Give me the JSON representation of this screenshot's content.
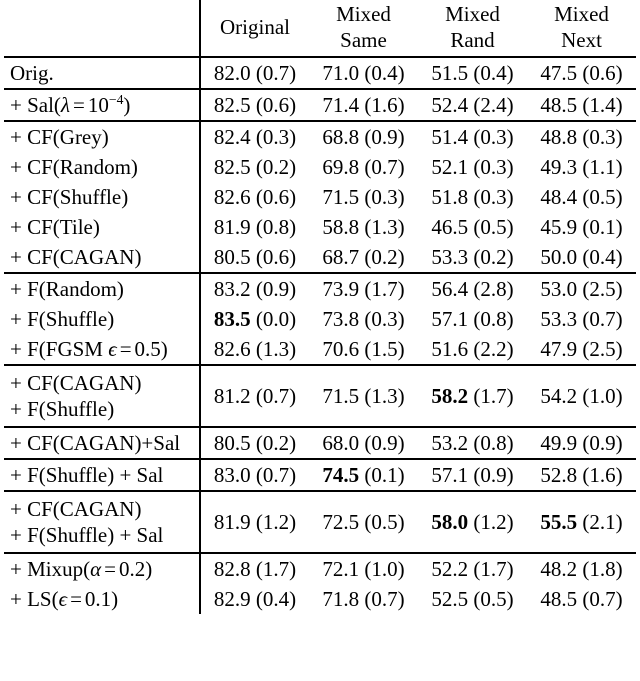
{
  "table": {
    "columns": [
      {
        "id": "label",
        "header_line1": "",
        "header_line2": ""
      },
      {
        "id": "original",
        "header_line1": "Original",
        "header_line2": ""
      },
      {
        "id": "mixed_same",
        "header_line1": "Mixed",
        "header_line2": "Same"
      },
      {
        "id": "mixed_rand",
        "header_line1": "Mixed",
        "header_line2": "Rand"
      },
      {
        "id": "mixed_next",
        "header_line1": "Mixed",
        "header_line2": "Next"
      }
    ],
    "groups": [
      {
        "rows": [
          {
            "label_line1": "Orig.",
            "label_line2": "",
            "cells": [
              {
                "mean": "82.0",
                "sd": "(0.7)",
                "bold": false
              },
              {
                "mean": "71.0",
                "sd": "(0.4)",
                "bold": false
              },
              {
                "mean": "51.5",
                "sd": "(0.4)",
                "bold": false
              },
              {
                "mean": "47.5",
                "sd": "(0.6)",
                "bold": false
              }
            ]
          }
        ]
      },
      {
        "rows": [
          {
            "label_line1": "+ Sal(λ = 10⁻⁴)",
            "label_math": true,
            "label_parts": {
              "prefix": "+ Sal(",
              "symbol": "λ",
              "relation": "=",
              "base": "10",
              "exponent": "−4",
              "suffix": ")"
            },
            "label_line2": "",
            "cells": [
              {
                "mean": "82.5",
                "sd": "(0.6)",
                "bold": false
              },
              {
                "mean": "71.4",
                "sd": "(1.6)",
                "bold": false
              },
              {
                "mean": "52.4",
                "sd": "(2.4)",
                "bold": false
              },
              {
                "mean": "48.5",
                "sd": "(1.4)",
                "bold": false
              }
            ]
          }
        ]
      },
      {
        "rows": [
          {
            "label_line1": "+ CF(Grey)",
            "label_line2": "",
            "cells": [
              {
                "mean": "82.4",
                "sd": "(0.3)",
                "bold": false
              },
              {
                "mean": "68.8",
                "sd": "(0.9)",
                "bold": false
              },
              {
                "mean": "51.4",
                "sd": "(0.3)",
                "bold": false
              },
              {
                "mean": "48.8",
                "sd": "(0.3)",
                "bold": false
              }
            ]
          },
          {
            "label_line1": "+ CF(Random)",
            "label_line2": "",
            "cells": [
              {
                "mean": "82.5",
                "sd": "(0.2)",
                "bold": false
              },
              {
                "mean": "69.8",
                "sd": "(0.7)",
                "bold": false
              },
              {
                "mean": "52.1",
                "sd": "(0.3)",
                "bold": false
              },
              {
                "mean": "49.3",
                "sd": "(1.1)",
                "bold": false
              }
            ]
          },
          {
            "label_line1": "+ CF(Shuffle)",
            "label_line2": "",
            "cells": [
              {
                "mean": "82.6",
                "sd": "(0.6)",
                "bold": false
              },
              {
                "mean": "71.5",
                "sd": "(0.3)",
                "bold": false
              },
              {
                "mean": "51.8",
                "sd": "(0.3)",
                "bold": false
              },
              {
                "mean": "48.4",
                "sd": "(0.5)",
                "bold": false
              }
            ]
          },
          {
            "label_line1": "+ CF(Tile)",
            "label_line2": "",
            "cells": [
              {
                "mean": "81.9",
                "sd": "(0.8)",
                "bold": false
              },
              {
                "mean": "58.8",
                "sd": "(1.3)",
                "bold": false
              },
              {
                "mean": "46.5",
                "sd": "(0.5)",
                "bold": false
              },
              {
                "mean": "45.9",
                "sd": "(0.1)",
                "bold": false
              }
            ]
          },
          {
            "label_line1": "+ CF(CAGAN)",
            "label_line2": "",
            "cells": [
              {
                "mean": "80.5",
                "sd": "(0.6)",
                "bold": false
              },
              {
                "mean": "68.7",
                "sd": "(0.2)",
                "bold": false
              },
              {
                "mean": "53.3",
                "sd": "(0.2)",
                "bold": false
              },
              {
                "mean": "50.0",
                "sd": "(0.4)",
                "bold": false
              }
            ]
          }
        ]
      },
      {
        "rows": [
          {
            "label_line1": "+ F(Random)",
            "label_line2": "",
            "cells": [
              {
                "mean": "83.2",
                "sd": "(0.9)",
                "bold": false
              },
              {
                "mean": "73.9",
                "sd": "(1.7)",
                "bold": false
              },
              {
                "mean": "56.4",
                "sd": "(2.8)",
                "bold": false
              },
              {
                "mean": "53.0",
                "sd": "(2.5)",
                "bold": false
              }
            ]
          },
          {
            "label_line1": "+ F(Shuffle)",
            "label_line2": "",
            "cells": [
              {
                "mean": "83.5",
                "sd": "(0.0)",
                "bold": true
              },
              {
                "mean": "73.8",
                "sd": "(0.3)",
                "bold": false
              },
              {
                "mean": "57.1",
                "sd": "(0.8)",
                "bold": false
              },
              {
                "mean": "53.3",
                "sd": "(0.7)",
                "bold": false
              }
            ]
          },
          {
            "label_line1": "+ F(FGSM ϵ = 0.5)",
            "label_math": true,
            "label_parts": {
              "prefix": "+ F(FGSM ",
              "symbol": "ϵ",
              "relation": "=",
              "base": "0.5",
              "exponent": "",
              "suffix": ")"
            },
            "label_line2": "",
            "cells": [
              {
                "mean": "82.6",
                "sd": "(1.3)",
                "bold": false
              },
              {
                "mean": "70.6",
                "sd": "(1.5)",
                "bold": false
              },
              {
                "mean": "51.6",
                "sd": "(2.2)",
                "bold": false
              },
              {
                "mean": "47.9",
                "sd": "(2.5)",
                "bold": false
              }
            ]
          }
        ]
      },
      {
        "rows": [
          {
            "label_line1": "+ CF(CAGAN)",
            "label_line2": "+ F(Shuffle)",
            "cells": [
              {
                "mean": "81.2",
                "sd": "(0.7)",
                "bold": false
              },
              {
                "mean": "71.5",
                "sd": "(1.3)",
                "bold": false
              },
              {
                "mean": "58.2",
                "sd": "(1.7)",
                "bold": true
              },
              {
                "mean": "54.2",
                "sd": "(1.0)",
                "bold": false
              }
            ]
          }
        ]
      },
      {
        "rows": [
          {
            "label_line1": "+ CF(CAGAN)+Sal",
            "label_line2": "",
            "cells": [
              {
                "mean": "80.5",
                "sd": "(0.2)",
                "bold": false
              },
              {
                "mean": "68.0",
                "sd": "(0.9)",
                "bold": false
              },
              {
                "mean": "53.2",
                "sd": "(0.8)",
                "bold": false
              },
              {
                "mean": "49.9",
                "sd": "(0.9)",
                "bold": false
              }
            ]
          }
        ]
      },
      {
        "rows": [
          {
            "label_line1": "+ F(Shuffle) + Sal",
            "label_line2": "",
            "cells": [
              {
                "mean": "83.0",
                "sd": "(0.7)",
                "bold": false
              },
              {
                "mean": "74.5",
                "sd": "(0.1)",
                "bold": true
              },
              {
                "mean": "57.1",
                "sd": "(0.9)",
                "bold": false
              },
              {
                "mean": "52.8",
                "sd": "(1.6)",
                "bold": false
              }
            ]
          }
        ]
      },
      {
        "rows": [
          {
            "label_line1": "+ CF(CAGAN)",
            "label_line2": "+ F(Shuffle) + Sal",
            "cells": [
              {
                "mean": "81.9",
                "sd": "(1.2)",
                "bold": false
              },
              {
                "mean": "72.5",
                "sd": "(0.5)",
                "bold": false
              },
              {
                "mean": "58.0",
                "sd": "(1.2)",
                "bold": true
              },
              {
                "mean": "55.5",
                "sd": "(2.1)",
                "bold": true
              }
            ]
          }
        ]
      },
      {
        "rows": [
          {
            "label_line1": "+ Mixup(α = 0.2)",
            "label_math": true,
            "label_parts": {
              "prefix": "+ Mixup(",
              "symbol": "α",
              "relation": "=",
              "base": "0.2",
              "exponent": "",
              "suffix": ")"
            },
            "label_line2": "",
            "cells": [
              {
                "mean": "82.8",
                "sd": "(1.7)",
                "bold": false
              },
              {
                "mean": "72.1",
                "sd": "(1.0)",
                "bold": false
              },
              {
                "mean": "52.2",
                "sd": "(1.7)",
                "bold": false
              },
              {
                "mean": "48.2",
                "sd": "(1.8)",
                "bold": false
              }
            ]
          },
          {
            "label_line1": "+ LS(ϵ = 0.1)",
            "label_math": true,
            "label_parts": {
              "prefix": "+ LS(",
              "symbol": "ϵ",
              "relation": "=",
              "base": "0.1",
              "exponent": "",
              "suffix": ")"
            },
            "label_line2": "",
            "cells": [
              {
                "mean": "82.9",
                "sd": "(0.4)",
                "bold": false
              },
              {
                "mean": "71.8",
                "sd": "(0.7)",
                "bold": false
              },
              {
                "mean": "52.5",
                "sd": "(0.5)",
                "bold": false
              },
              {
                "mean": "48.5",
                "sd": "(0.7)",
                "bold": false
              }
            ]
          }
        ]
      }
    ]
  }
}
